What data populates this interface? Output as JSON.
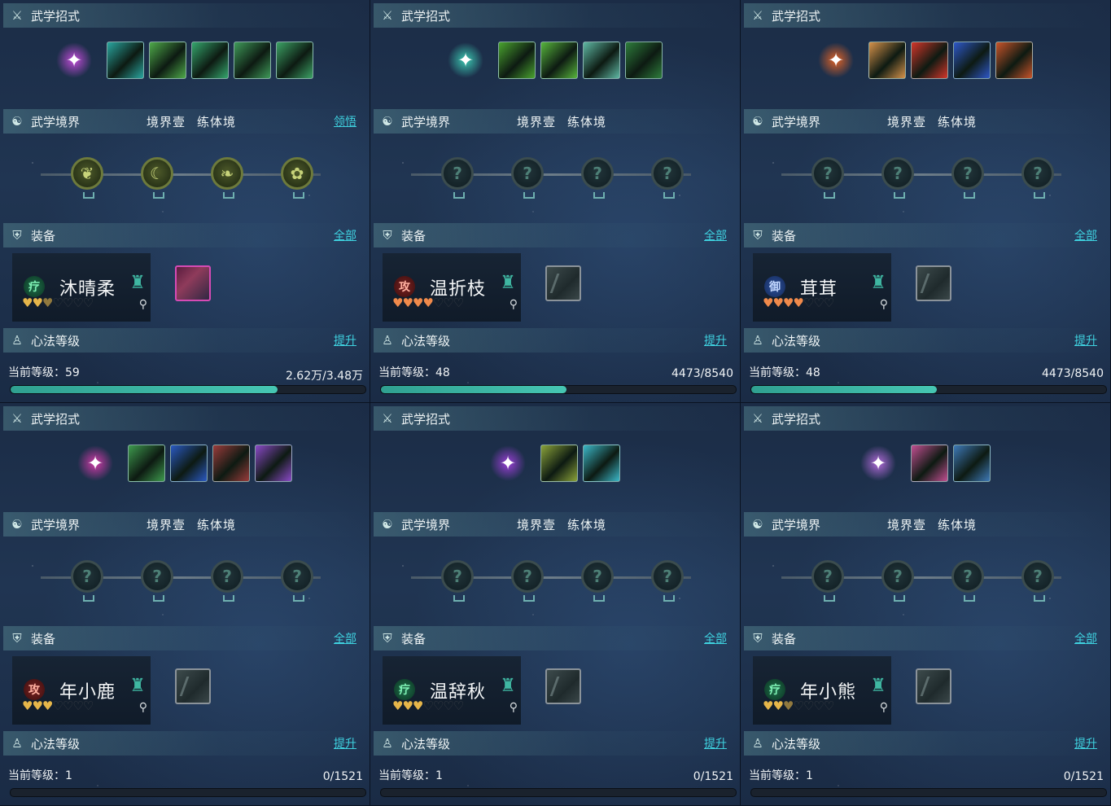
{
  "labels": {
    "skills_title": "武学招式",
    "realm_title": "武学境界",
    "realm_level": "境界壹",
    "realm_stage": "练体境",
    "realm_action": "领悟",
    "equip_title": "装备",
    "equip_all": "全部",
    "heart_title": "心法等级",
    "heart_upgrade": "提升",
    "current_level_prefix": "当前等级："
  },
  "colors": {
    "accent_teal": "#3fd2e0",
    "progress_fill": "#2fa090",
    "heart_gold": "#e6b64a",
    "heart_orange": "#f08a4b"
  },
  "panels": [
    {
      "skill_main": {
        "icon": "purple-meditation-icon",
        "color": "#c14bd8"
      },
      "skills": [
        {
          "icon": "teal-wave-skill-icon",
          "color": "#2aa6a0"
        },
        {
          "icon": "green-wind-skill-icon",
          "color": "#4faa4a"
        },
        {
          "icon": "green-swirl-skill-icon",
          "color": "#35a66d"
        },
        {
          "icon": "green-leaf-skill-icon",
          "color": "#3f9a59"
        },
        {
          "icon": "green-dragon-skill-icon",
          "color": "#3ca265"
        }
      ],
      "show_realm_action": true,
      "realm_nodes_lit": true,
      "character": {
        "name": "沐晴柔",
        "role": "疗",
        "role_type": "heal",
        "hearts_full": 2,
        "hearts_half": 1,
        "hearts_total": 7,
        "heart_color": "gold"
      },
      "equip_special": true,
      "level": "59",
      "progress_text": "2.62万/3.48万",
      "progress": 0.753
    },
    {
      "skill_main": {
        "icon": "teal-figure-icon",
        "color": "#3ac7b0"
      },
      "skills": [
        {
          "icon": "green-blade-skill-icon",
          "color": "#4aa42f"
        },
        {
          "icon": "green-slash-skill-icon",
          "color": "#57b53c"
        },
        {
          "icon": "cyan-ring-skill-icon",
          "color": "#5fb8a4"
        },
        {
          "icon": "green-yinyang-skill-icon",
          "color": "#2e7d3c"
        }
      ],
      "show_realm_action": false,
      "realm_nodes_lit": false,
      "character": {
        "name": "温折枝",
        "role": "攻",
        "role_type": "atk",
        "hearts_full": 4,
        "hearts_half": 0,
        "hearts_total": 7,
        "heart_color": "orange"
      },
      "equip_special": false,
      "level": "48",
      "progress_text": "4473/8540",
      "progress": 0.524
    },
    {
      "skill_main": {
        "icon": "fire-figure-icon",
        "color": "#e06226"
      },
      "skills": [
        {
          "icon": "buddha-face-skill-icon",
          "color": "#d6924a"
        },
        {
          "icon": "red-burst-skill-icon",
          "color": "#d4362a"
        },
        {
          "icon": "blue-crescent-skill-icon",
          "color": "#2e58c9"
        },
        {
          "icon": "fire-swirl-skill-icon",
          "color": "#c9542a"
        }
      ],
      "show_realm_action": false,
      "realm_nodes_lit": false,
      "character": {
        "name": "茸茸",
        "role": "御",
        "role_type": "def",
        "hearts_full": 4,
        "hearts_half": 0,
        "hearts_total": 7,
        "heart_color": "orange"
      },
      "equip_special": false,
      "level": "48",
      "progress_text": "4473/8540",
      "progress": 0.524
    },
    {
      "skill_main": {
        "icon": "pink-rune-icon",
        "color": "#d23aa8"
      },
      "skills": [
        {
          "icon": "green-spark-skill-icon",
          "color": "#3e9a4e"
        },
        {
          "icon": "blue-serpent-skill-icon",
          "color": "#2a59c2"
        },
        {
          "icon": "red-root-skill-icon",
          "color": "#9a3b3b"
        },
        {
          "icon": "purple-spin-skill-icon",
          "color": "#8b4ac8"
        }
      ],
      "show_realm_action": false,
      "realm_nodes_lit": false,
      "character": {
        "name": "年小鹿",
        "role": "攻",
        "role_type": "atk",
        "hearts_full": 3,
        "hearts_half": 0,
        "hearts_total": 7,
        "heart_color": "gold"
      },
      "equip_special": false,
      "level": "1",
      "progress_text": "0/1521",
      "progress": 0
    },
    {
      "skill_main": {
        "icon": "violet-figure-icon",
        "color": "#9a3fd6"
      },
      "skills": [
        {
          "icon": "golden-hand-skill-icon",
          "color": "#8ba33a"
        },
        {
          "icon": "cyan-vortex-skill-icon",
          "color": "#3bb8c9"
        }
      ],
      "show_realm_action": false,
      "realm_nodes_lit": false,
      "character": {
        "name": "温辞秋",
        "role": "疗",
        "role_type": "heal",
        "hearts_full": 3,
        "hearts_half": 0,
        "hearts_total": 7,
        "heart_color": "gold"
      },
      "equip_special": false,
      "level": "1",
      "progress_text": "0/1521",
      "progress": 0
    },
    {
      "skill_main": {
        "icon": "violet-crystal-icon",
        "color": "#b06ad8"
      },
      "skills": [
        {
          "icon": "pink-dancer-skill-icon",
          "color": "#c24f92"
        },
        {
          "icon": "blue-fan-skill-icon",
          "color": "#3e7ab8"
        }
      ],
      "show_realm_action": false,
      "realm_nodes_lit": false,
      "character": {
        "name": "年小熊",
        "role": "疗",
        "role_type": "heal",
        "hearts_full": 2,
        "hearts_half": 1,
        "hearts_total": 7,
        "heart_color": "gold"
      },
      "equip_special": false,
      "level": "1",
      "progress_text": "0/1521",
      "progress": 0
    }
  ]
}
